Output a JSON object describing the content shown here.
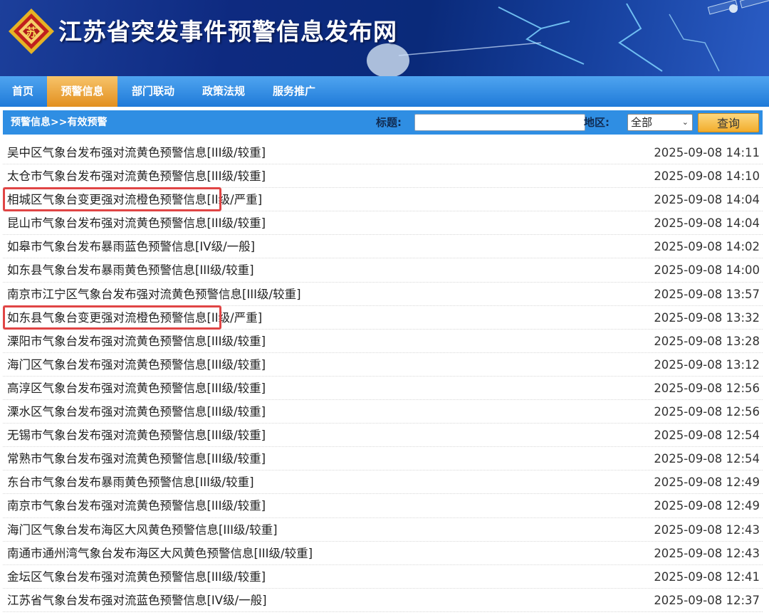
{
  "site": {
    "title": "江苏省突发事件预警信息发布网",
    "logo_text": "苏"
  },
  "nav": {
    "items": [
      {
        "label": "首页",
        "active": false
      },
      {
        "label": "预警信息",
        "active": true
      },
      {
        "label": "部门联动",
        "active": false
      },
      {
        "label": "政策法规",
        "active": false
      },
      {
        "label": "服务推广",
        "active": false
      }
    ]
  },
  "subbar": {
    "breadcrumb": "预警信息>>有效预警",
    "title_label": "标题:",
    "title_value": "",
    "region_label": "地区:",
    "region_value": "全部",
    "query_label": "查询"
  },
  "warnings": [
    {
      "title": "吴中区气象台发布强对流黄色预警信息[III级/较重]",
      "time": "2025-09-08 14:11",
      "highlighted": false
    },
    {
      "title": "太仓市气象台发布强对流黄色预警信息[III级/较重]",
      "time": "2025-09-08 14:10",
      "highlighted": false
    },
    {
      "title": "相城区气象台变更强对流橙色预警信息[II级/严重]",
      "time": "2025-09-08 14:04",
      "highlighted": true
    },
    {
      "title": "昆山市气象台发布强对流黄色预警信息[III级/较重]",
      "time": "2025-09-08 14:04",
      "highlighted": false
    },
    {
      "title": "如皋市气象台发布暴雨蓝色预警信息[IV级/一般]",
      "time": "2025-09-08 14:02",
      "highlighted": false
    },
    {
      "title": "如东县气象台发布暴雨黄色预警信息[III级/较重]",
      "time": "2025-09-08 14:00",
      "highlighted": false
    },
    {
      "title": "南京市江宁区气象台发布强对流黄色预警信息[III级/较重]",
      "time": "2025-09-08 13:57",
      "highlighted": false
    },
    {
      "title": "如东县气象台变更强对流橙色预警信息[II级/严重]",
      "time": "2025-09-08 13:32",
      "highlighted": true
    },
    {
      "title": "溧阳市气象台发布强对流黄色预警信息[III级/较重]",
      "time": "2025-09-08 13:28",
      "highlighted": false
    },
    {
      "title": "海门区气象台发布强对流黄色预警信息[III级/较重]",
      "time": "2025-09-08 13:12",
      "highlighted": false
    },
    {
      "title": "高淳区气象台发布强对流黄色预警信息[III级/较重]",
      "time": "2025-09-08 12:56",
      "highlighted": false
    },
    {
      "title": "溧水区气象台发布强对流黄色预警信息[III级/较重]",
      "time": "2025-09-08 12:56",
      "highlighted": false
    },
    {
      "title": "无锡市气象台发布强对流黄色预警信息[III级/较重]",
      "time": "2025-09-08 12:54",
      "highlighted": false
    },
    {
      "title": "常熟市气象台发布强对流黄色预警信息[III级/较重]",
      "time": "2025-09-08 12:54",
      "highlighted": false
    },
    {
      "title": "东台市气象台发布暴雨黄色预警信息[III级/较重]",
      "time": "2025-09-08 12:49",
      "highlighted": false
    },
    {
      "title": "南京市气象台发布强对流黄色预警信息[III级/较重]",
      "time": "2025-09-08 12:49",
      "highlighted": false
    },
    {
      "title": "海门区气象台发布海区大风黄色预警信息[III级/较重]",
      "time": "2025-09-08 12:43",
      "highlighted": false
    },
    {
      "title": "南通市通州湾气象台发布海区大风黄色预警信息[III级/较重]",
      "time": "2025-09-08 12:43",
      "highlighted": false
    },
    {
      "title": "金坛区气象台发布强对流黄色预警信息[III级/较重]",
      "time": "2025-09-08 12:41",
      "highlighted": false
    },
    {
      "title": "江苏省气象台发布强对流蓝色预警信息[IV级/一般]",
      "time": "2025-09-08 12:37",
      "highlighted": false
    }
  ],
  "colors": {
    "highlight_border": "#e04545",
    "nav_active": "#e28f1f",
    "nav_bg": "#1f7ad8"
  }
}
